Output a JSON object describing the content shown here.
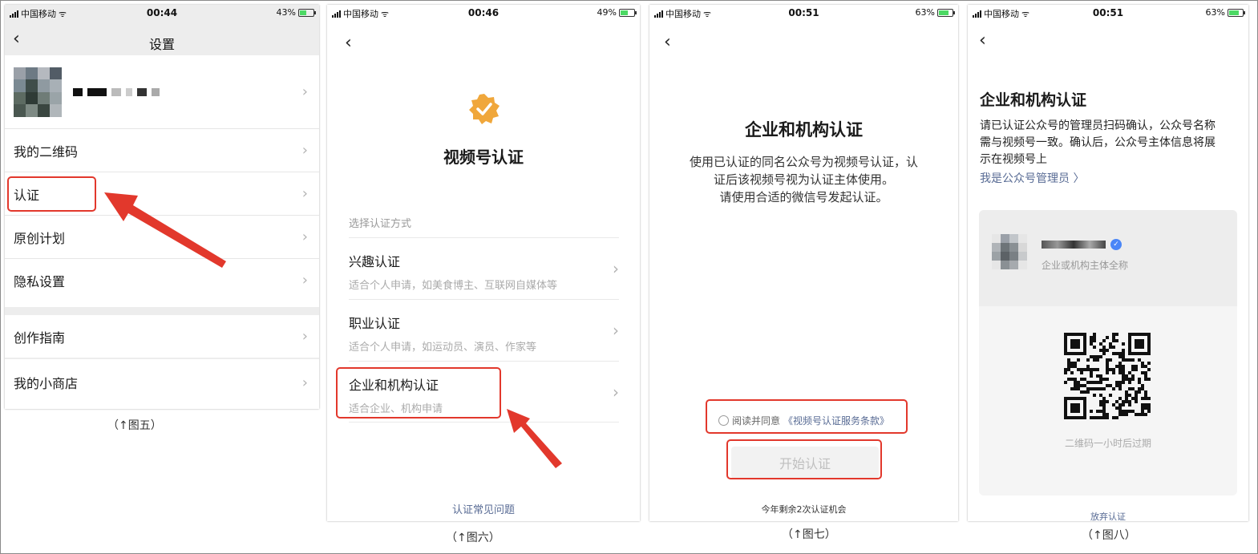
{
  "phone1": {
    "status": {
      "carrier": "中国移动",
      "time": "00:44",
      "battery": "43%"
    },
    "nav_title": "设置",
    "menu": [
      "我的二维码",
      "认证",
      "原创计划",
      "隐私设置"
    ],
    "menu2": [
      "创作指南"
    ],
    "menu3": [
      "我的小商店"
    ],
    "caption": "（↑图五）"
  },
  "phone2": {
    "status": {
      "carrier": "中国移动",
      "time": "00:46",
      "battery": "49%"
    },
    "title": "视频号认证",
    "section_label": "选择认证方式",
    "options": [
      {
        "title": "兴趣认证",
        "sub": "适合个人申请，如美食博主、互联网自媒体等"
      },
      {
        "title": "职业认证",
        "sub": "适合个人申请，如运动员、演员、作家等"
      },
      {
        "title": "企业和机构认证",
        "sub": "适合企业、机构申请"
      }
    ],
    "faq": "认证常见问题",
    "caption": "（↑图六）"
  },
  "phone3": {
    "status": {
      "carrier": "中国移动",
      "time": "00:51",
      "battery": "63%"
    },
    "title": "企业和机构认证",
    "desc_lines": [
      "使用已认证的同名公众号为视频号认证，认",
      "证后该视频号视为认证主体使用。",
      "请使用合适的微信号发起认证。"
    ],
    "agree_prefix": "阅读并同意",
    "agree_link": "《视频号认证服务条款》",
    "start_button": "开始认证",
    "remaining": "今年剩余2次认证机会",
    "caption": "（↑图七）"
  },
  "phone4": {
    "status": {
      "carrier": "中国移动",
      "time": "00:51",
      "battery": "63%"
    },
    "title": "企业和机构认证",
    "desc_lines": [
      "请已认证公众号的管理员扫码确认，公众号名称",
      "需与视频号一致。确认后，公众号主体信息将展",
      "示在视频号上"
    ],
    "admin_link": "我是公众号管理员 〉",
    "card_sub": "企业或机构主体全称",
    "qr_expire": "二维码一小时后过期",
    "abandon": "放弃认证",
    "caption": "（↑图八）"
  },
  "colors": {
    "accent_red": "#e2382c",
    "link_blue": "#586b94",
    "badge_orange": "#f0a73b",
    "verified_blue": "#4a86f7"
  },
  "icons": [
    "back-chevron-icon",
    "chevron-right-icon",
    "wifi-icon",
    "signal-icon",
    "battery-icon",
    "verified-badge-icon",
    "qr-code-icon",
    "radio-icon"
  ]
}
